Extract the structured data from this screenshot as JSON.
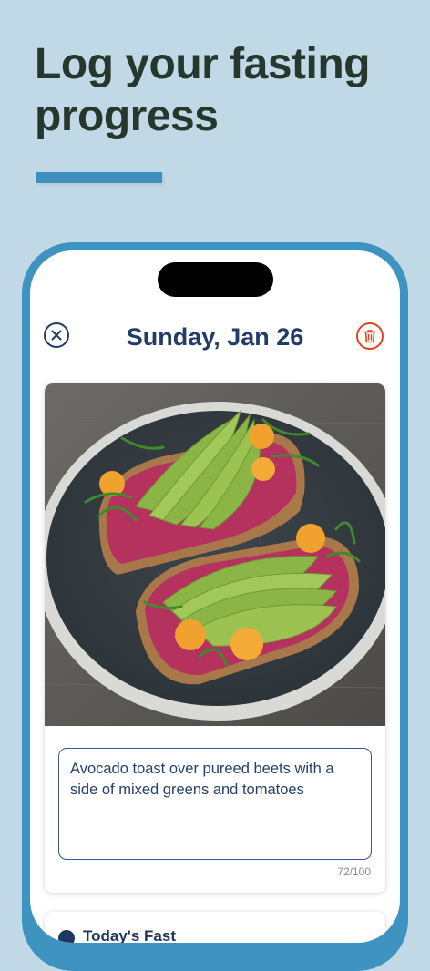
{
  "headline": {
    "line1": "Log your fasting",
    "line2": "progress"
  },
  "header": {
    "date_title": "Sunday, Jan 26",
    "close_icon": "close-circle-icon",
    "delete_icon": "trash-icon"
  },
  "entry": {
    "photo_icon": "food-photo",
    "note_value": "Avocado toast over pureed beets with a side of mixed greens and tomatoes",
    "char_count": "72/100"
  },
  "next_card": {
    "label": "Today's Fast"
  },
  "colors": {
    "background": "#c1d8e6",
    "accent": "#3f93c0",
    "headline": "#26382e",
    "title": "#223c69",
    "danger": "#e7411c"
  }
}
